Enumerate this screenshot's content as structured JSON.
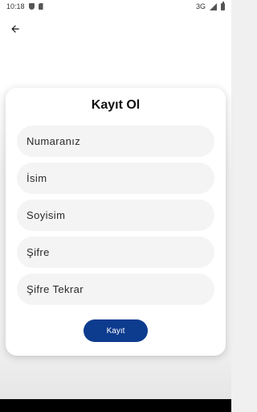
{
  "status_bar": {
    "time": "10:18",
    "network": "3G",
    "icons": [
      "shield-icon",
      "sim-card-icon",
      "signal-icon",
      "battery-icon"
    ]
  },
  "header": {
    "back_icon": "arrow-left-icon"
  },
  "form": {
    "title": "Kayıt Ol",
    "fields": {
      "number": {
        "placeholder": "Numaranız"
      },
      "name": {
        "placeholder": "İsim"
      },
      "surname": {
        "placeholder": "Soyisim"
      },
      "password": {
        "placeholder": "Şifre"
      },
      "password_repeat": {
        "placeholder": "Şifre Tekrar"
      }
    },
    "submit_label": "Kayıt"
  },
  "colors": {
    "primary": "#0d3b8e",
    "field_bg": "#f4f4f4",
    "card_bg": "#ffffff"
  }
}
